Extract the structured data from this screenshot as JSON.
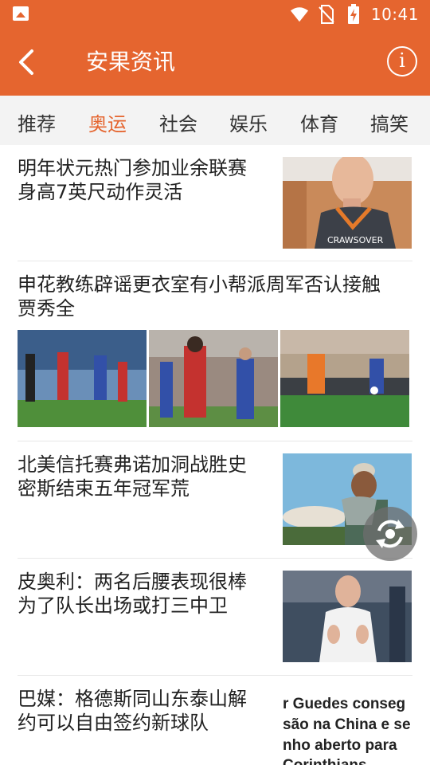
{
  "status_bar": {
    "time": "10:41",
    "icons": [
      "gallery-icon",
      "wifi-icon",
      "no-sim-icon",
      "battery-charging-icon"
    ]
  },
  "header": {
    "title": "安果资讯",
    "back_icon": "chevron-left-icon",
    "info_icon": "info-icon",
    "info_glyph": "i"
  },
  "tabs": [
    {
      "label": "推荐",
      "active": false
    },
    {
      "label": "奥运",
      "active": true
    },
    {
      "label": "社会",
      "active": false
    },
    {
      "label": "娱乐",
      "active": false
    },
    {
      "label": "体育",
      "active": false
    },
    {
      "label": "搞笑",
      "active": false
    }
  ],
  "articles": [
    {
      "title_line1": "明年状元热门参加业余联赛",
      "title_line2": "身高7英尺动作灵活",
      "thumb_text": "CRAWSOVER"
    },
    {
      "title_line1": "申花教练辟谣更衣室有小帮派周军否认接触",
      "title_line2": "贾秀全"
    },
    {
      "title_line1": "北美信托赛弗诺加洞战胜史",
      "title_line2": "密斯结束五年冠军荒"
    },
    {
      "title_line1": "皮奥利：两名后腰表现很棒",
      "title_line2": "为了队长出场或打三中卫"
    },
    {
      "title_line1": "巴媒：格德斯同山东泰山解",
      "title_line2": "约可以自由签约新球队",
      "thumb_text": [
        "r Guedes conseg",
        "são na China e se",
        "nho aberto para",
        "Corinthians"
      ]
    }
  ],
  "colors": {
    "accent": "#e5652f",
    "tab_bg": "#f3f3f3",
    "text": "#222222"
  }
}
